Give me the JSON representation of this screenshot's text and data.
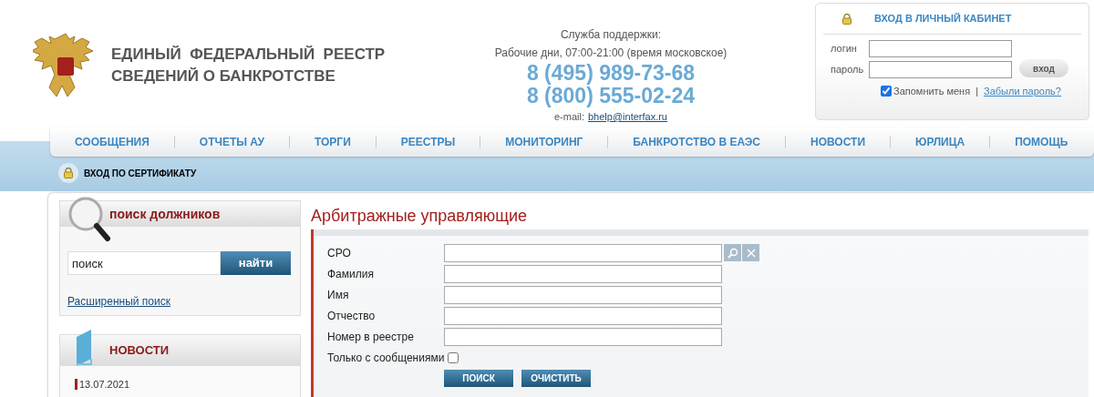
{
  "header": {
    "title_lines": [
      "ЕДИНЫЙ  ФЕДЕРАЛЬНЫЙ  РЕЕСТР",
      "СВЕДЕНИЙ О БАНКРОТСТВЕ"
    ],
    "support": {
      "label": "Служба поддержки:",
      "hours": "Рабочие дни, 07:00-21:00 (время московское)",
      "phones": [
        "8 (495) 989-73-68",
        "8 (800) 555-02-24"
      ],
      "email_label": "e-mail:",
      "email": "bhelp@interfax.ru"
    },
    "login": {
      "title": "ВХОД В ЛИЧНЫЙ КАБИНЕТ",
      "login_label": "логин",
      "password_label": "пароль",
      "button": "вход",
      "remember": {
        "label": "Запомнить меня",
        "checked": true
      },
      "separator": "|",
      "forgot": "Забыли пароль?"
    }
  },
  "nav": [
    {
      "label": "СООБЩЕНИЯ"
    },
    {
      "label": "ОТЧЕТЫ АУ"
    },
    {
      "label": "ТОРГИ"
    },
    {
      "label": "РЕЕСТРЫ"
    },
    {
      "label": "МОНИТОРИНГ"
    },
    {
      "label": "БАНКРОТСТВО В ЕАЭС"
    },
    {
      "label": "НОВОСТИ"
    },
    {
      "label": "ЮРЛИЦА"
    },
    {
      "label": "ПОМОЩЬ"
    }
  ],
  "certificate_login": "ВХОД ПО СЕРТИФИКАТУ",
  "debtor_search": {
    "title": "поиск должников",
    "value": "поиск",
    "button": "найти",
    "advanced": "Расширенный поиск"
  },
  "news": {
    "title": "НОВОСТИ",
    "items": [
      {
        "date": "13.07.2021"
      }
    ]
  },
  "page_title": "Арбитражные управляющие",
  "form": {
    "fields": [
      {
        "label": "СРО",
        "kind": "lookup"
      },
      {
        "label": "Фамилия",
        "kind": "text"
      },
      {
        "label": "Имя",
        "kind": "text"
      },
      {
        "label": "Отчество",
        "kind": "text"
      },
      {
        "label": "Номер в реестре",
        "kind": "text"
      },
      {
        "label": "Только с сообщениями",
        "kind": "checkbox",
        "checked": false
      }
    ],
    "buttons": [
      "ПОИСК",
      "ОЧИСТИТЬ"
    ]
  }
}
